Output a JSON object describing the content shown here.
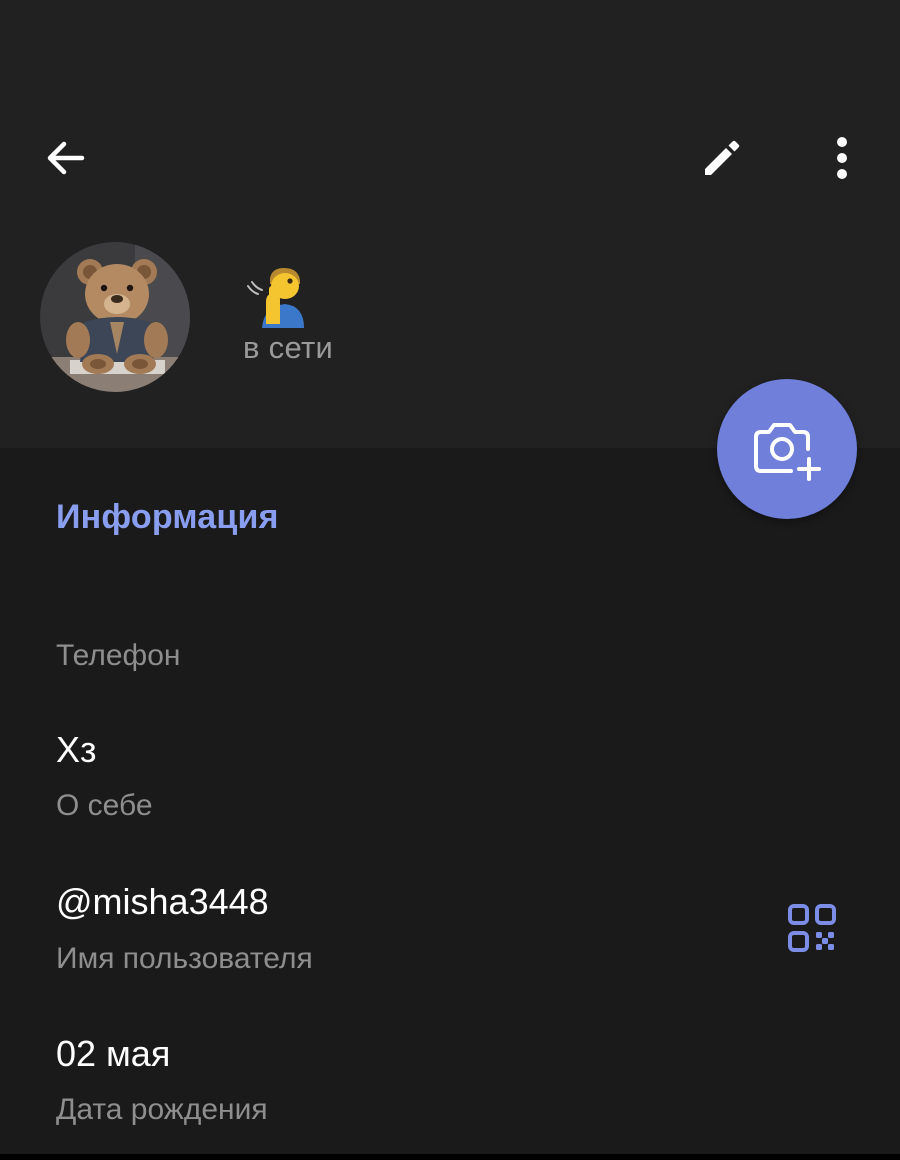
{
  "header": {
    "status": "в сети"
  },
  "info": {
    "section_title": "Информация",
    "rows": [
      {
        "value": "",
        "label": "Телефон"
      },
      {
        "value": "Хз",
        "label": "О себе"
      },
      {
        "value": "@misha3448",
        "label": "Имя пользователя"
      },
      {
        "value": "02 мая",
        "label": "Дата рождения"
      }
    ]
  },
  "icons": {
    "back": "arrow-left-icon",
    "edit": "pencil-icon",
    "more": "more-vertical-icon",
    "set_photo": "camera-add-icon",
    "qr": "qr-code-icon",
    "name_emoji": "shushing-person-emoji"
  },
  "colors": {
    "accent": "#6f7fda",
    "accent_text": "#8a9ef0",
    "header_bg": "#212121",
    "content_bg": "#1a1a1a"
  }
}
